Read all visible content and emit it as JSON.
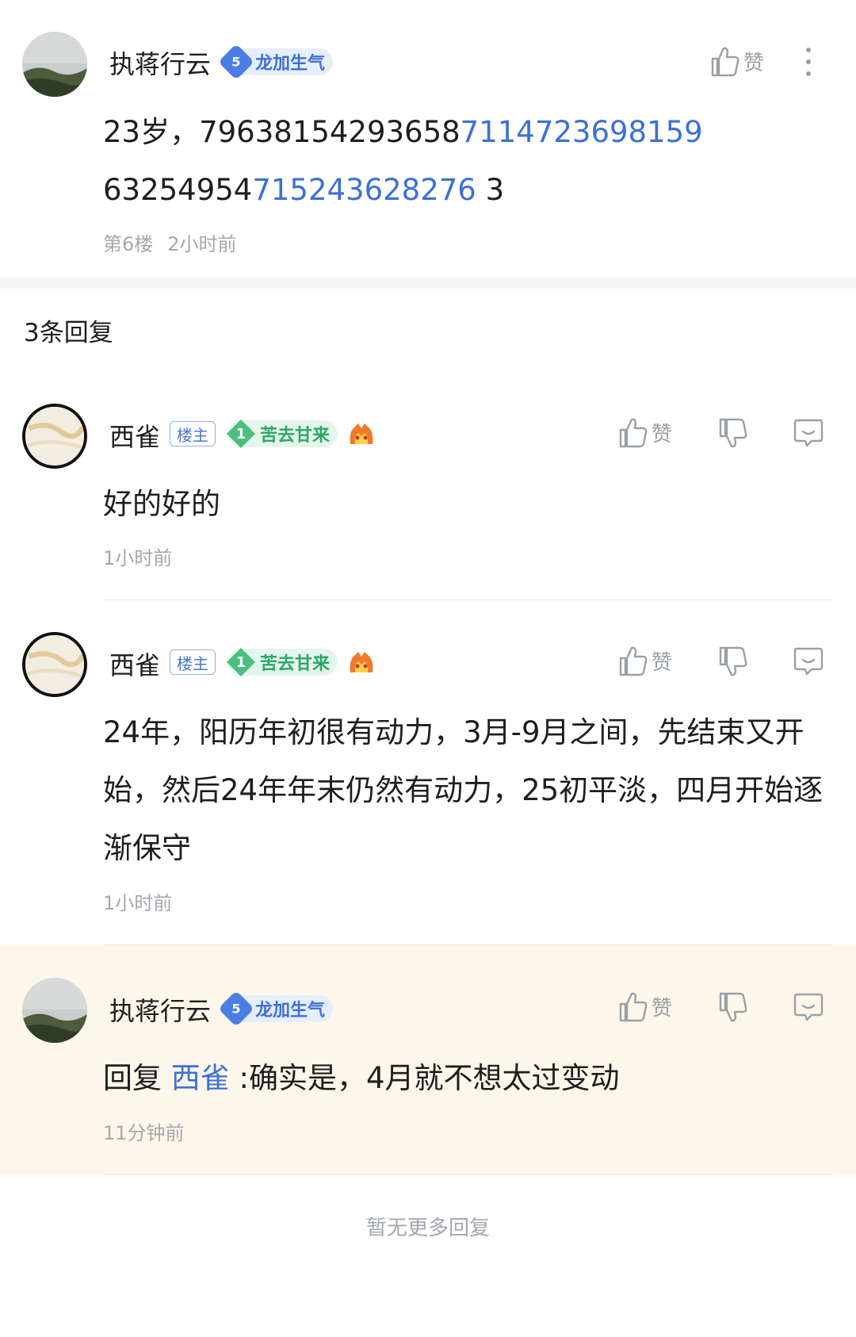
{
  "main_post": {
    "username": "执蒋行云",
    "badge_level": "5",
    "badge_title": "龙加生气",
    "like_label": "赞",
    "content_prefix": "23岁，79638154293658",
    "content_link1": "7114723698159",
    "content_mid": "63254954",
    "content_link2": "715243628276",
    "content_suffix": " 3",
    "floor": "第6楼",
    "time": "2小时前"
  },
  "replies_header": "3条回复",
  "replies": [
    {
      "username": "西雀",
      "owner_tag": "楼主",
      "badge_level": "1",
      "badge_title": "苦去甘来",
      "like_label": "赞",
      "content": "好的好的",
      "time": "1小时前"
    },
    {
      "username": "西雀",
      "owner_tag": "楼主",
      "badge_level": "1",
      "badge_title": "苦去甘来",
      "like_label": "赞",
      "content": "24年，阳历年初很有动力，3月-9月之间，先结束又开始，然后24年年末仍然有动力，25初平淡，四月开始逐渐保守",
      "time": "1小时前"
    },
    {
      "username": "执蒋行云",
      "badge_level": "5",
      "badge_title": "龙加生气",
      "like_label": "赞",
      "reply_prefix": "回复 ",
      "reply_target": "西雀",
      "reply_body": " :确实是，4月就不想太过变动",
      "time": "11分钟前"
    }
  ],
  "footer": "暂无更多回复",
  "colors": {
    "link": "#3d6fd9",
    "meta": "#a4a8ae",
    "highlight_bg": "#fcf7ea",
    "badge_blue": "#4a7ee6",
    "badge_green": "#4cbf7f"
  }
}
